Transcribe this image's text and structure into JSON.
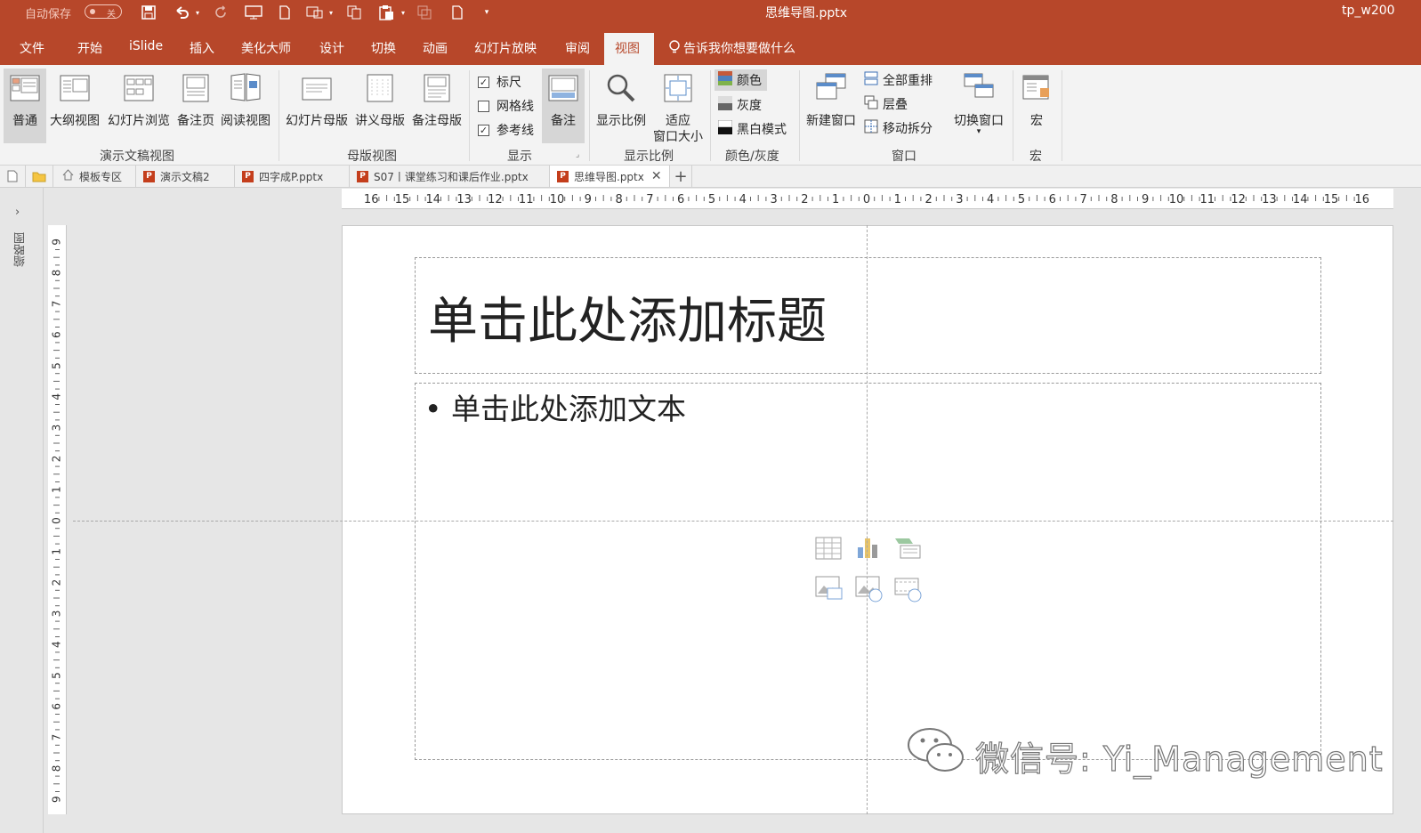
{
  "titlebar": {
    "autosave_label": "自动保存",
    "autosave_state": "关",
    "doc_title": "思维导图.pptx",
    "user": "tp_w200"
  },
  "ribbon_tabs": [
    "文件",
    "开始",
    "iSlide",
    "插入",
    "美化大师",
    "设计",
    "切换",
    "动画",
    "幻灯片放映",
    "审阅"
  ],
  "active_tab": "视图",
  "tell_me": "告诉我你想要做什么",
  "groups": {
    "presentation_views": {
      "label": "演示文稿视图",
      "buttons": [
        "普通",
        "大纲视图",
        "幻灯片浏览",
        "备注页",
        "阅读视图"
      ]
    },
    "master_views": {
      "label": "母版视图",
      "buttons": [
        "幻灯片母版",
        "讲义母版",
        "备注母版"
      ]
    },
    "show": {
      "label": "显示",
      "ruler": "标尺",
      "gridlines": "网格线",
      "guides": "参考线",
      "notes": "备注"
    },
    "zoom": {
      "label": "显示比例",
      "zoom": "显示比例",
      "fit_line1": "适应",
      "fit_line2": "窗口大小"
    },
    "color": {
      "label": "颜色/灰度",
      "color": "颜色",
      "grayscale": "灰度",
      "bw": "黑白模式"
    },
    "window": {
      "label": "窗口",
      "new_window": "新建窗口",
      "arrange_all": "全部重排",
      "cascade": "层叠",
      "move_split": "移动拆分",
      "switch_windows": "切换窗口"
    },
    "macros": {
      "label": "宏",
      "macros": "宏"
    }
  },
  "doc_tabs": [
    {
      "label": "模板专区",
      "icon": "home-icon"
    },
    {
      "label": "演示文稿2",
      "icon": "pptx-icon"
    },
    {
      "label": "四字成P.pptx",
      "icon": "pptx-icon"
    },
    {
      "label": "S07丨课堂练习和课后作业.pptx",
      "icon": "pptx-icon"
    },
    {
      "label": "思维导图.pptx",
      "icon": "pptx-icon",
      "active": true
    }
  ],
  "thumbnail_pane_label": "缩略图",
  "slide": {
    "title_placeholder": "单击此处添加标题",
    "body_placeholder": "• 单击此处添加文本"
  },
  "watermark": "微信号: Yi_Management",
  "ruler_h": [
    "16",
    "15",
    "14",
    "13",
    "12",
    "11",
    "10",
    "9",
    "8",
    "7",
    "6",
    "5",
    "4",
    "3",
    "2",
    "1",
    "0",
    "1",
    "2",
    "3",
    "4",
    "5",
    "6",
    "7",
    "8",
    "9",
    "10",
    "11",
    "12",
    "13",
    "14",
    "15",
    "16"
  ],
  "ruler_v": [
    "9",
    "8",
    "7",
    "6",
    "5",
    "4",
    "3",
    "2",
    "1",
    "0",
    "1",
    "2",
    "3",
    "4",
    "5",
    "6",
    "7",
    "8",
    "9"
  ],
  "colors": {
    "accent": "#b7472a",
    "ribbon_bg": "#f3f3f3"
  }
}
